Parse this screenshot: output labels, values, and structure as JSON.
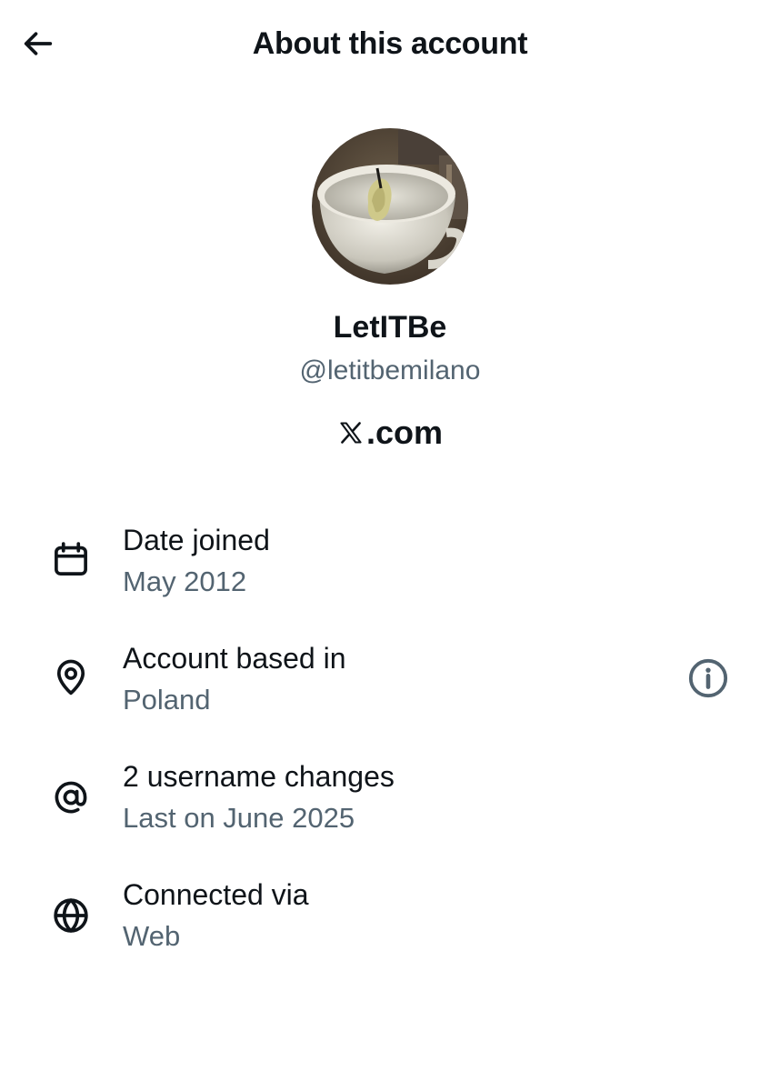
{
  "header": {
    "title": "About this account",
    "back_icon": "arrow-left-icon"
  },
  "profile": {
    "display_name": "LetITBe",
    "handle": "@letitbemilano",
    "site_logo_icon": "x-logo-icon",
    "site_suffix": ".com"
  },
  "rows": [
    {
      "icon": "calendar-icon",
      "label": "Date joined",
      "value": "May 2012"
    },
    {
      "icon": "location-pin-icon",
      "label": "Account based in",
      "value": "Poland",
      "trailing_icon": "info-icon"
    },
    {
      "icon": "at-sign-icon",
      "label": "2 username changes",
      "value": "Last on June 2025"
    },
    {
      "icon": "globe-icon",
      "label": "Connected via",
      "value": "Web"
    }
  ],
  "colors": {
    "primary_text": "#0f1419",
    "secondary_text": "#536471",
    "background": "#ffffff"
  }
}
